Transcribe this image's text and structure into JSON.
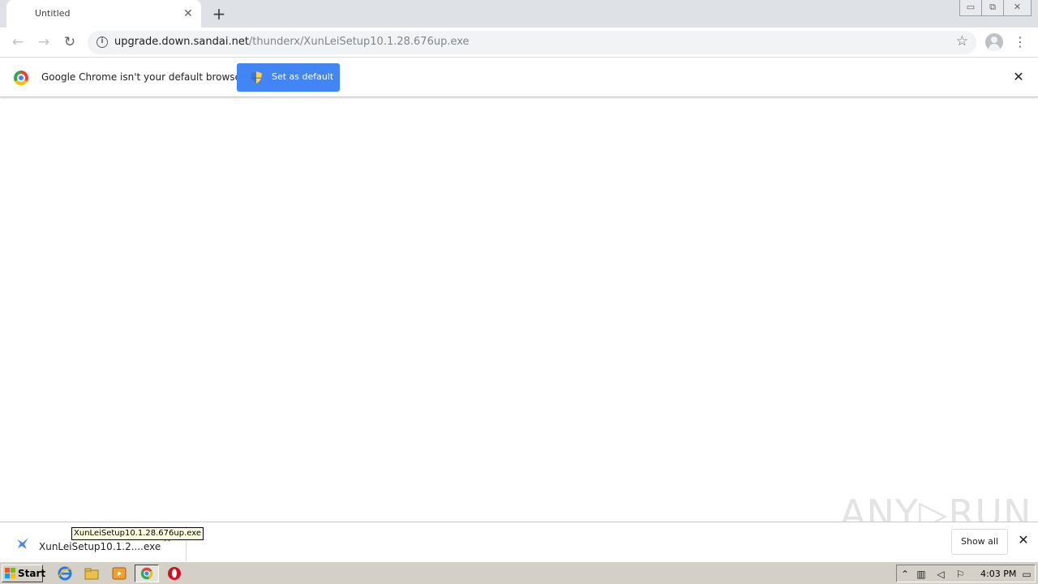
{
  "browser": {
    "tab": {
      "title": "Untitled"
    },
    "window_controls": {
      "minimize": "▭",
      "restore": "⧉",
      "close": "✕"
    }
  },
  "toolbar": {
    "url_host": "upgrade.down.sandai.net",
    "url_path": "/thunderx/XunLeiSetup10.1.28.676up.exe"
  },
  "infobar": {
    "message": "Google Chrome isn't your default browser",
    "button_label": "Set as default"
  },
  "watermark": {
    "text_left": "ANY",
    "text_right": "RUN"
  },
  "download_shelf": {
    "item_name": "XunLeiSetup10.1.2....exe",
    "tooltip": "XunLeiSetup10.1.28.676up.exe",
    "show_all_label": "Show all"
  },
  "taskbar": {
    "start_label": "Start",
    "clock": "4:03 PM"
  },
  "colors": {
    "accent_blue": "#4285f4",
    "tabstrip_bg": "#dee1e6",
    "taskbar_bg": "#d4d0c8"
  }
}
